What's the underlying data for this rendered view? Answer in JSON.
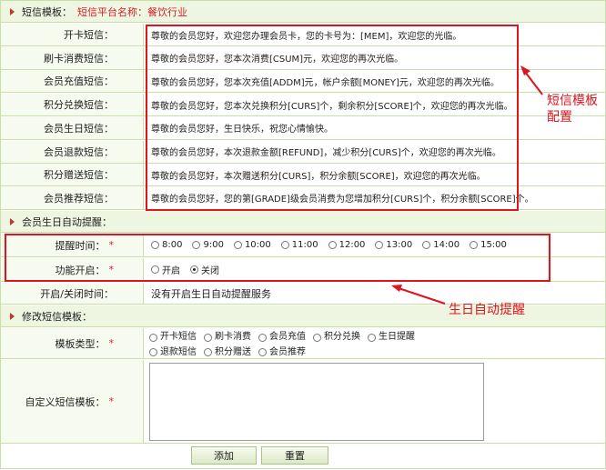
{
  "sms_template_section": {
    "title": "短信模板：",
    "platform": "短信平台名称：餐饮行业"
  },
  "sms_rows": [
    {
      "label": "开卡短信：",
      "text": "尊敬的会员您好，欢迎您办理会员卡，您的卡号为：[MEM]，欢迎您的光临。"
    },
    {
      "label": "刷卡消费短信：",
      "text": "尊敬的会员您好，您本次消费[CSUM]元，欢迎您的再次光临。"
    },
    {
      "label": "会员充值短信：",
      "text": "尊敬的会员您好，您本次充值[ADDM]元，帐户余额[MONEY]元，欢迎您的再次光临。"
    },
    {
      "label": "积分兑换短信：",
      "text": "尊敬的会员您好，您本次兑换积分[CURS]个，剩余积分[SCORE]个，欢迎您的再次光临。"
    },
    {
      "label": "会员生日短信：",
      "text": "尊敬的会员您好，生日快乐，祝您心情愉快。"
    },
    {
      "label": "会员退款短信：",
      "text": "尊敬的会员您好，本次退款金额[REFUND]，减少积分[CURS]个，欢迎您的再次光临。"
    },
    {
      "label": "积分赠送短信：",
      "text": "尊敬的会员您好，本次赠送积分[CURS]，积分余额[SCORE]，欢迎您的再次光临。"
    },
    {
      "label": "会员推荐短信：",
      "text": "尊敬的会员您好，您的第[GRADE]级会员消费为您增加积分[CURS]个，积分余额[SCORE]个。"
    }
  ],
  "birthday_section": {
    "title": "会员生日自动提醒："
  },
  "remind_time": {
    "label": "提醒时间：",
    "options": [
      "8:00",
      "9:00",
      "10:00",
      "11:00",
      "12:00",
      "13:00",
      "14:00",
      "15:00"
    ]
  },
  "function_enable": {
    "label": "功能开启：",
    "options": [
      "开启",
      "关闭"
    ],
    "selected": "关闭"
  },
  "onoff_time": {
    "label": "开启/关闭时间：",
    "value": "没有开启生日自动提醒服务"
  },
  "modify_section": {
    "title": "修改短信模板："
  },
  "template_type": {
    "label": "模板类型：",
    "options_row1": [
      "开卡短信",
      "刷卡消费",
      "会员充值",
      "积分兑换",
      "生日提醒"
    ],
    "options_row2": [
      "退款短信",
      "积分赠送",
      "会员推荐"
    ]
  },
  "custom_template": {
    "label": "自定义短信模板："
  },
  "buttons": {
    "add": "添加",
    "reset": "重置"
  },
  "annotations": {
    "sms_config_line1": "短信模板",
    "sms_config_line2": "配置",
    "birthday_remind": "生日自动提醒"
  },
  "colors": {
    "annotation": "#e0141e",
    "label_bg": "#f6faef",
    "border": "#c9dfa8"
  }
}
